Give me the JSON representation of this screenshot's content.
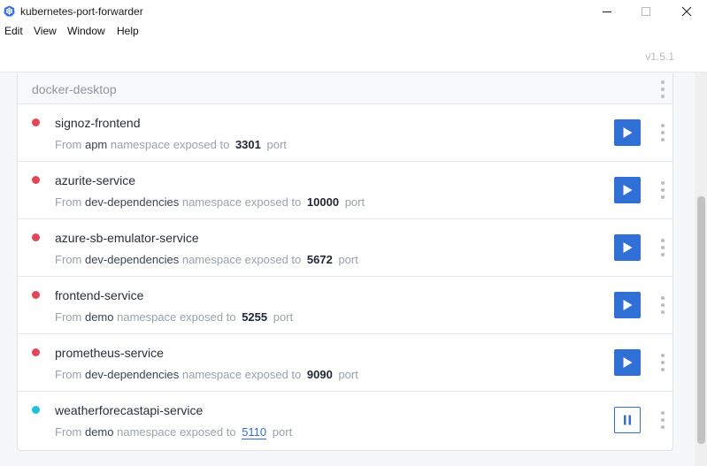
{
  "window": {
    "title": "kubernetes-port-forwarder",
    "controls": [
      "minimize",
      "maximize",
      "close"
    ]
  },
  "menu": [
    "Edit",
    "View",
    "Window",
    "Help"
  ],
  "app": {
    "version": "v1.5.1",
    "cluster": "docker-desktop",
    "labels": {
      "from": "From",
      "namespace_exposed": "namespace exposed to",
      "port": "port"
    },
    "services": [
      {
        "name": "signoz-frontend",
        "namespace": "apm",
        "port": "3301",
        "running": false
      },
      {
        "name": "azurite-service",
        "namespace": "dev-dependencies",
        "port": "10000",
        "running": false
      },
      {
        "name": "azure-sb-emulator-service",
        "namespace": "dev-dependencies",
        "port": "5672",
        "running": false
      },
      {
        "name": "frontend-service",
        "namespace": "demo",
        "port": "5255",
        "running": false
      },
      {
        "name": "prometheus-service",
        "namespace": "dev-dependencies",
        "port": "9090",
        "running": false
      },
      {
        "name": "weatherforecastapi-service",
        "namespace": "demo",
        "port": "5110",
        "running": true
      }
    ],
    "colors": {
      "accent": "#2f6fd6",
      "stopped_dot": "#e0485a",
      "running_dot": "#22c0d6"
    }
  }
}
